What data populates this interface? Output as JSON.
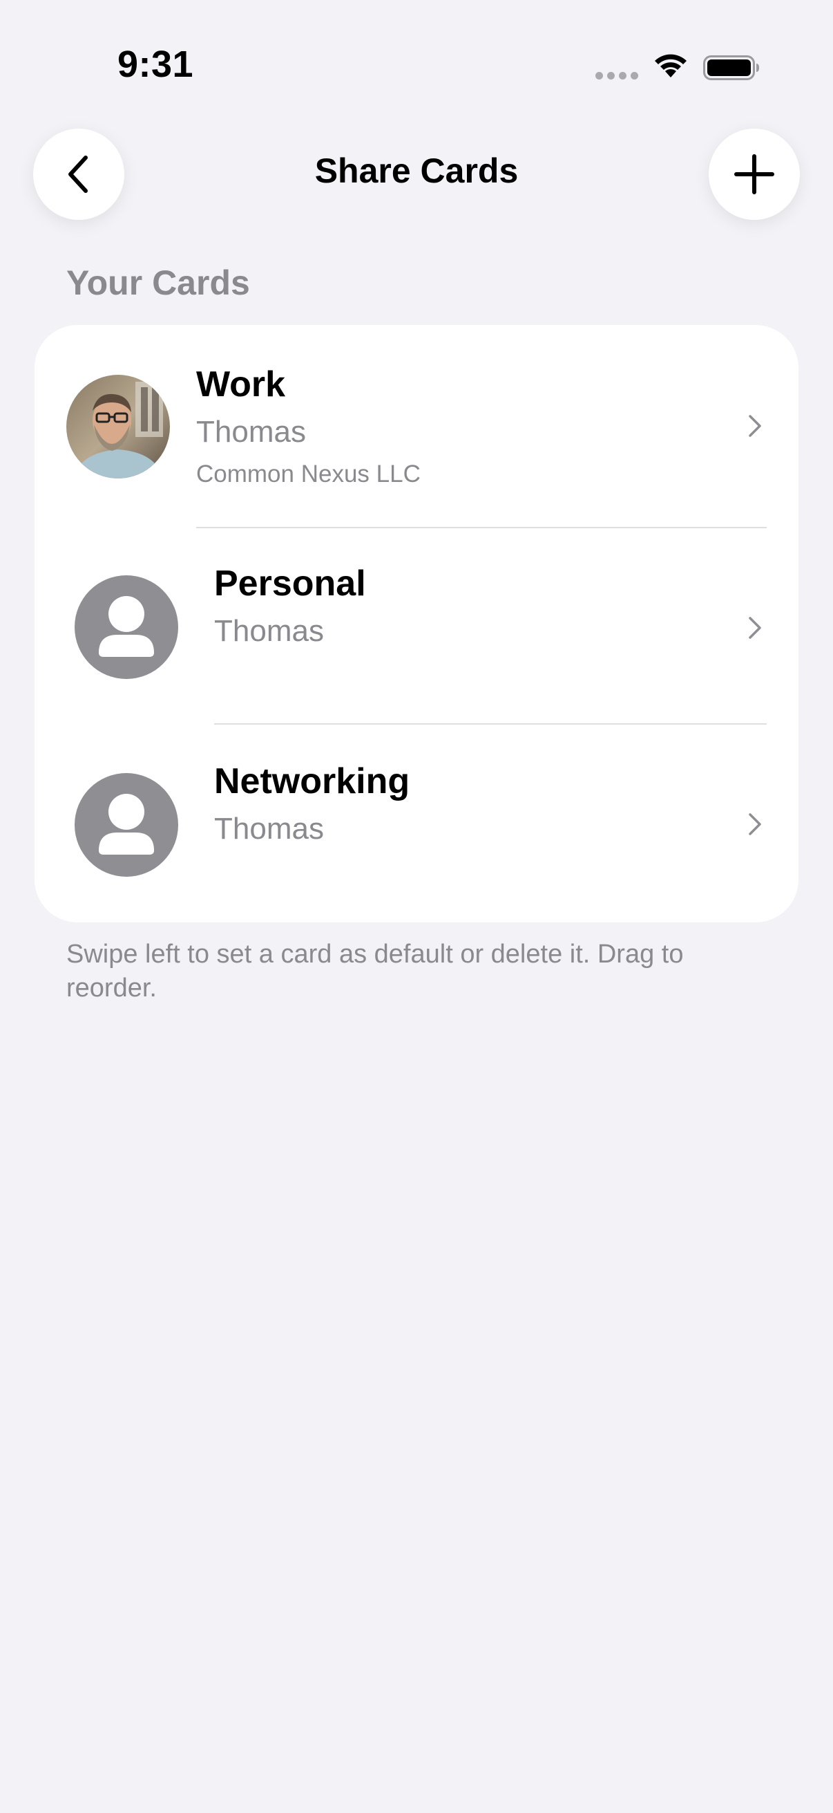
{
  "status_bar": {
    "time": "9:31"
  },
  "nav": {
    "title": "Share Cards",
    "back_icon": "chevron-left-icon",
    "add_icon": "plus-icon"
  },
  "section": {
    "header": "Your Cards"
  },
  "cards": [
    {
      "title": "Work",
      "name": "Thomas",
      "company": "Common Nexus LLC",
      "avatar": "photo"
    },
    {
      "title": "Personal",
      "name": "Thomas",
      "avatar": "person-silhouette-icon"
    },
    {
      "title": "Networking",
      "name": "Thomas",
      "avatar": "person-silhouette-icon"
    }
  ],
  "footer": {
    "note": "Swipe left to set a card as default or delete it. Drag to reorder."
  },
  "colors": {
    "background": "#f2f2f7",
    "card_background": "#ffffff",
    "secondary_text": "#8a8a8e",
    "avatar_gray": "#8e8e93"
  }
}
